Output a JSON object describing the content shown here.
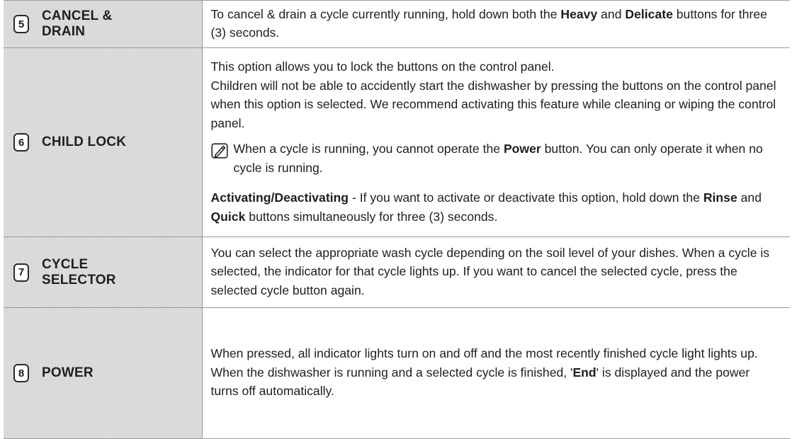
{
  "rows": [
    {
      "number": "5",
      "name_lines": [
        "CANCEL &",
        "DRAIN"
      ],
      "text": {
        "p1_a": "To cancel & drain a cycle currently running, hold down both the ",
        "p1_b1": "Heavy",
        "p1_c": " and ",
        "p1_b2": "Delicate",
        "p1_d": " buttons for three (3) seconds."
      }
    },
    {
      "number": "6",
      "name_lines": [
        "CHILD LOCK"
      ],
      "text": {
        "p1": "This option allows you to lock the buttons on the control panel.",
        "p2": "Children will not be able to accidently start the dishwasher by pressing the buttons on the control panel when this option is selected. We recommend activating this feature while cleaning or wiping the control panel.",
        "note_icon": "note-pencil-icon",
        "note_a": "When a cycle is running, you cannot operate the ",
        "note_b": "Power",
        "note_c": " button. You can only operate it when no cycle is running.",
        "p3_b1": "Activating/Deactivating",
        "p3_a": " - If you want to activate or deactivate this option, hold down the ",
        "p3_b2": "Rinse",
        "p3_c": " and ",
        "p3_b3": "Quick",
        "p3_d": " buttons simultaneously for three (3) seconds."
      }
    },
    {
      "number": "7",
      "name_lines": [
        "CYCLE",
        "SELECTOR"
      ],
      "text": {
        "p1": "You can select the appropriate wash cycle depending on the soil level of your dishes. When a cycle is selected, the indicator for that cycle lights up. If you want to cancel the selected cycle, press the selected cycle button again."
      }
    },
    {
      "number": "8",
      "name_lines": [
        "POWER"
      ],
      "text": {
        "p1": "When pressed, all indicator lights turn on and off and the most recently finished cycle light lights up.",
        "p2_a": "When the dishwasher is running and a selected cycle is finished, '",
        "p2_b": "End",
        "p2_c": "' is displayed and the power turns off automatically."
      }
    }
  ],
  "colors": {
    "label_bg": "#d2d2d2",
    "border": "#9a9a9a",
    "text": "#1e1e1e"
  }
}
